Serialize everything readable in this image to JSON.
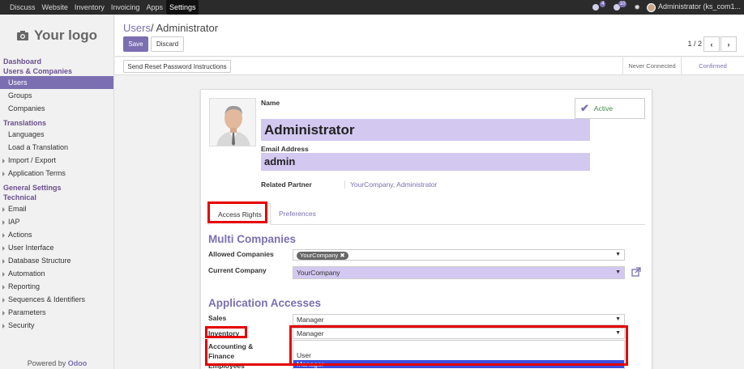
{
  "topnav": {
    "items": [
      "Discuss",
      "Website",
      "Inventory",
      "Invoicing",
      "Apps",
      "Settings"
    ],
    "active_index": 5,
    "chat_badge": "4",
    "activity_badge": "10",
    "user": "Administrator (ks_com1..."
  },
  "sidebar": {
    "logo_text": "Your logo",
    "sections": [
      {
        "title": "Dashboard",
        "items": []
      },
      {
        "title": "Users & Companies",
        "items": [
          "Users",
          "Groups",
          "Companies"
        ]
      },
      {
        "title": "Translations",
        "items": [
          "Languages",
          "Load a Translation",
          "Import / Export",
          "Application Terms"
        ]
      },
      {
        "title": "General Settings",
        "items": []
      },
      {
        "title": "Technical",
        "items": [
          "Email",
          "IAP",
          "Actions",
          "User Interface",
          "Database Structure",
          "Automation",
          "Reporting",
          "Sequences & Identifiers",
          "Parameters",
          "Security"
        ]
      }
    ],
    "powered_by": "Powered by",
    "powered_brand": "Odoo"
  },
  "control_panel": {
    "breadcrumb_parent": "Users",
    "breadcrumb_sep": "/",
    "breadcrumb_current": "Administrator",
    "save_label": "Save",
    "discard_label": "Discard",
    "pager": "1 / 2"
  },
  "status_bar": {
    "reset_button": "Send Reset Password Instructions",
    "stages": [
      "Never Connected",
      "Confirmed"
    ],
    "current_stage": "Confirmed"
  },
  "form": {
    "active_label": "Active",
    "name_label": "Name",
    "name_value": "Administrator",
    "email_label": "Email Address",
    "email_value": "admin",
    "related_partner_label": "Related Partner",
    "related_partner_value": "YourCompany, Administrator",
    "tabs": [
      "Access Rights",
      "Preferences"
    ],
    "multi_companies_title": "Multi Companies",
    "allowed_companies_label": "Allowed Companies",
    "allowed_companies_tag": "YourCompany",
    "current_company_label": "Current Company",
    "current_company_value": "YourCompany",
    "app_access_title": "Application Accesses",
    "sales_label": "Sales",
    "sales_value": "Manager",
    "inventory_label": "Inventory",
    "inventory_value": "Manager",
    "accounting_label_1": "Accounting &",
    "accounting_label_2": "Finance",
    "employees_label": "Employees",
    "dropdown_options": [
      "",
      "User",
      "Manager"
    ],
    "dropdown_selected": "Manager"
  },
  "colors": {
    "accent": "#7c6fb1",
    "required_field": "#d3c8f0",
    "highlight": "#e40000"
  }
}
